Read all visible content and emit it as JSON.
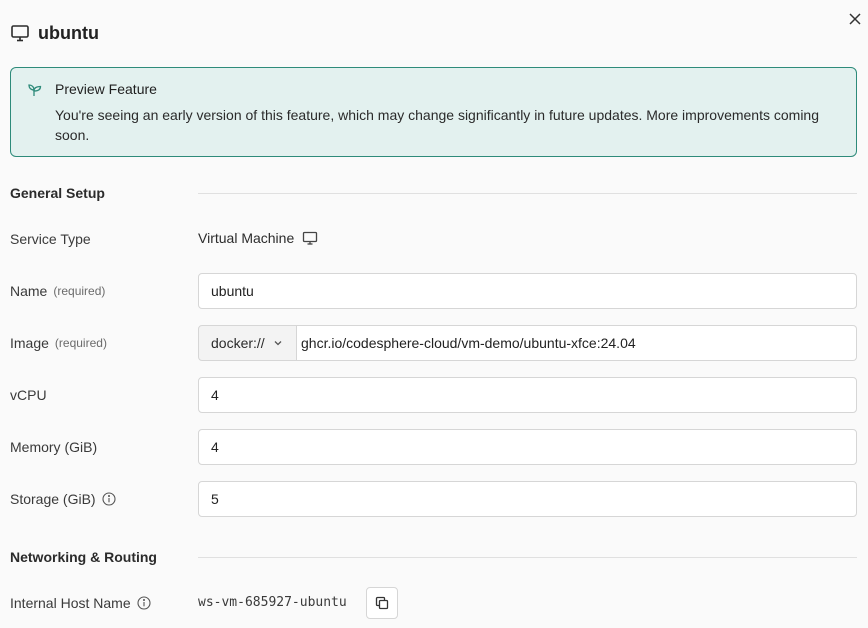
{
  "header": {
    "title": "ubuntu",
    "icon": "monitor-icon",
    "close_icon": "close-icon"
  },
  "preview": {
    "icon": "sprout-icon",
    "title": "Preview Feature",
    "body": "You're seeing an early version of this feature, which may change significantly in future updates. More improvements coming soon.",
    "accent_color": "#2e8b7a",
    "background_color": "#e3f1ef"
  },
  "general": {
    "section_title": "General Setup",
    "service_type_label": "Service Type",
    "service_type_value": "Virtual Machine",
    "service_type_icon": "monitor-icon",
    "name_label": "Name",
    "name_required": "(required)",
    "name_value": "ubuntu",
    "image_label": "Image",
    "image_required": "(required)",
    "image_protocol": "docker://",
    "image_value": "ghcr.io/codesphere-cloud/vm-demo/ubuntu-xfce:24.04",
    "vcpu_label": "vCPU",
    "vcpu_value": "4",
    "memory_label": "Memory (GiB)",
    "memory_value": "4",
    "storage_label": "Storage (GiB)",
    "storage_info_icon": "info-icon",
    "storage_value": "5"
  },
  "networking": {
    "section_title": "Networking & Routing",
    "host_label": "Internal Host Name",
    "host_info_icon": "info-icon",
    "host_value": "ws-vm-685927-ubuntu",
    "copy_icon": "copy-icon"
  }
}
